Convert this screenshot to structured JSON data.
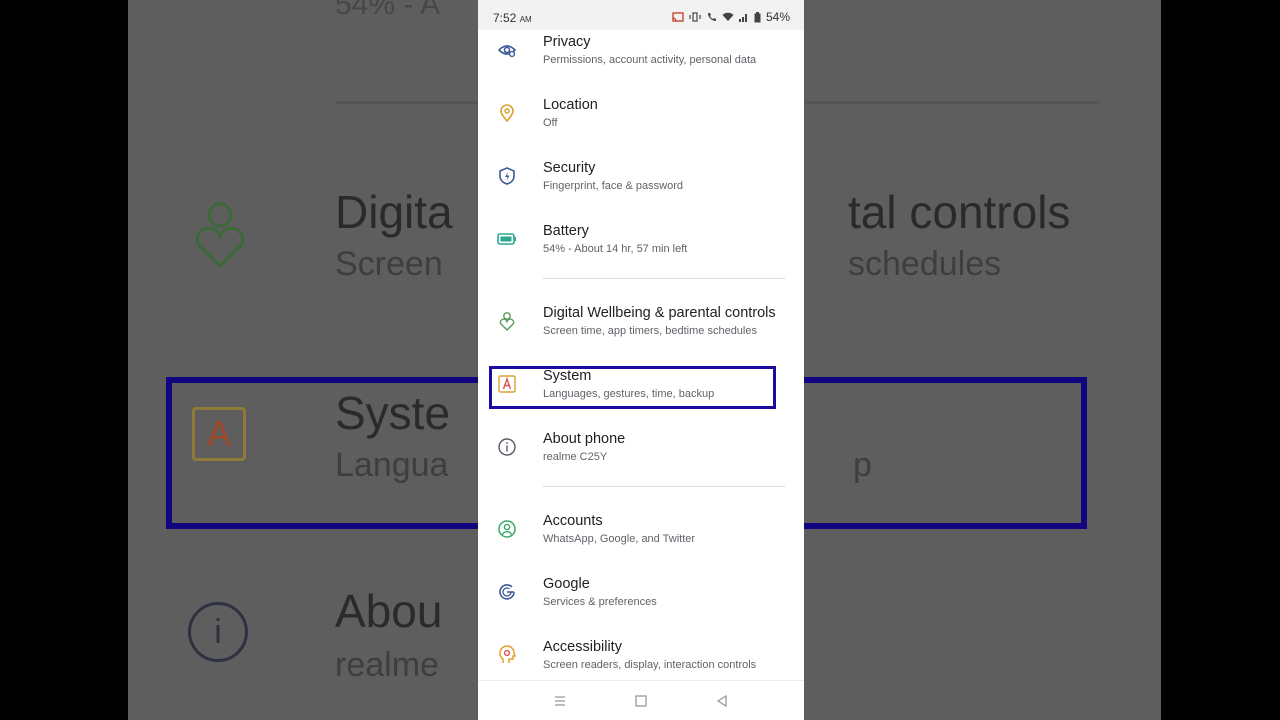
{
  "status_bar": {
    "time": "7:52",
    "ampm": "AM",
    "battery_percent": "54%"
  },
  "settings": [
    {
      "title": "Privacy",
      "subtitle": "Permissions, account activity, personal data",
      "icon": "privacy-eye-icon"
    },
    {
      "title": "Location",
      "subtitle": "Off",
      "icon": "location-pin-icon"
    },
    {
      "title": "Security",
      "subtitle": "Fingerprint, face & password",
      "icon": "security-shield-icon"
    },
    {
      "title": "Battery",
      "subtitle": "54% - About 14 hr, 57 min left",
      "icon": "battery-icon"
    },
    {
      "title": "Digital Wellbeing & parental controls",
      "subtitle": "Screen time, app timers, bedtime schedules",
      "icon": "wellbeing-heart-icon"
    },
    {
      "title": "System",
      "subtitle": "Languages, gestures, time, backup",
      "icon": "system-a-icon",
      "highlighted": true
    },
    {
      "title": "About phone",
      "subtitle": "realme C25Y",
      "icon": "info-icon"
    },
    {
      "title": "Accounts",
      "subtitle": "WhatsApp, Google, and Twitter",
      "icon": "accounts-icon"
    },
    {
      "title": "Google",
      "subtitle": "Services & preferences",
      "icon": "google-g-icon"
    },
    {
      "title": "Accessibility",
      "subtitle": "Screen readers, display, interaction controls",
      "icon": "accessibility-head-icon"
    }
  ],
  "background_zoom": {
    "battery_text": "54% - A",
    "wellbeing_title_left": "Digita",
    "wellbeing_title_right": "tal controls",
    "wellbeing_sub_left": "Screen",
    "wellbeing_sub_right": "schedules",
    "system_icon_letter": "A",
    "system_title": "Syste",
    "system_sub_left": "Langua",
    "system_sub_right": "p",
    "about_icon_letter": "i",
    "about_title": "Abou",
    "about_sub": "realme"
  },
  "colors": {
    "highlight_border": "#1a0c9e",
    "background": "#000000",
    "panel": "#ffffff"
  }
}
